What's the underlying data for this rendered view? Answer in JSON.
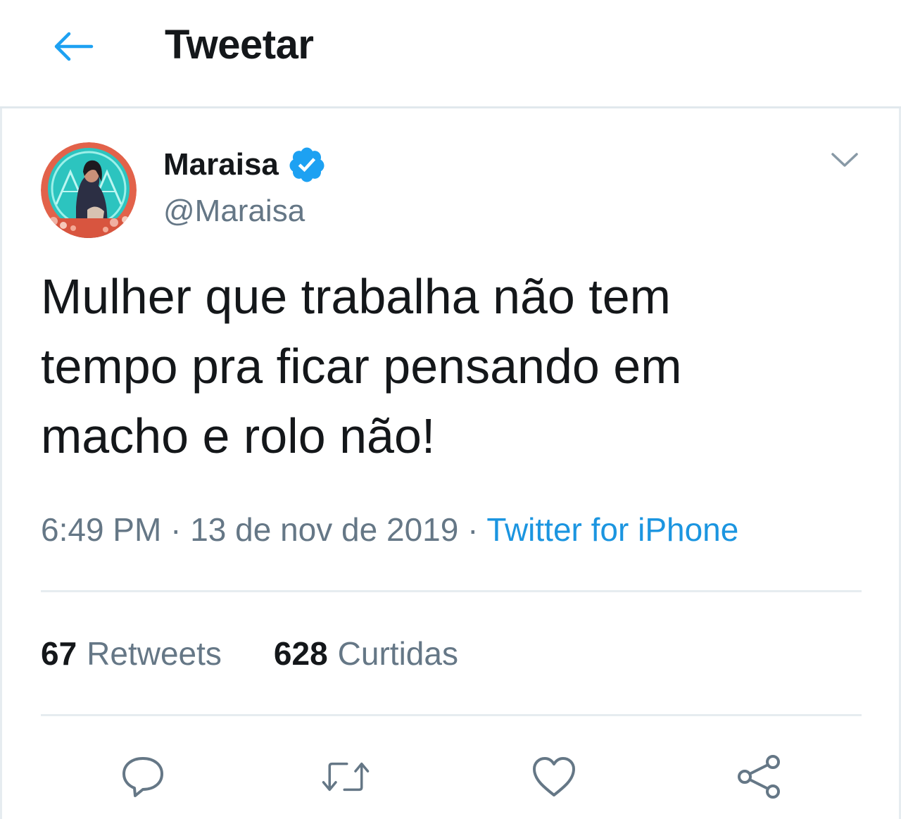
{
  "header": {
    "title": "Tweetar",
    "back_icon": "arrow-left-icon"
  },
  "colors": {
    "accent": "#1da1f2",
    "link": "#1b95e0",
    "text_primary": "#14171a",
    "text_secondary": "#657786",
    "divider": "#e6ecf0"
  },
  "tweet": {
    "author": {
      "name": "Maraisa",
      "handle": "@Maraisa",
      "verified": true,
      "verified_icon": "verified-badge-icon"
    },
    "menu_icon": "chevron-down-icon",
    "text": "Mulher que trabalha não tem\ntempo pra ficar pensando em\nmacho e rolo não!",
    "time": "6:49 PM",
    "date": "13 de nov de 2019",
    "separator": "·",
    "source": "Twitter for iPhone",
    "stats": {
      "retweets_count": "67",
      "retweets_label": "Retweets",
      "likes_count": "628",
      "likes_label": "Curtidas"
    },
    "actions": [
      "reply-icon",
      "retweet-icon",
      "like-icon",
      "share-icon"
    ]
  }
}
